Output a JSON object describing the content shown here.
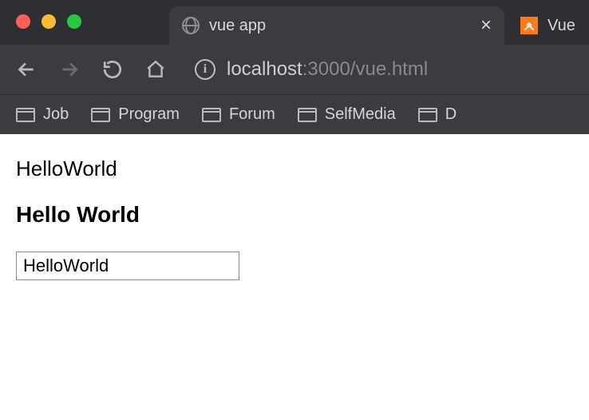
{
  "tabs": {
    "active": {
      "title": "vue app"
    },
    "inactive": {
      "title": "Vue"
    }
  },
  "address": {
    "host": "localhost",
    "port": ":3000",
    "path": "/vue.html"
  },
  "bookmarks": [
    {
      "label": "Job"
    },
    {
      "label": "Program"
    },
    {
      "label": "Forum"
    },
    {
      "label": "SelfMedia"
    },
    {
      "label": "D"
    }
  ],
  "content": {
    "text": "HelloWorld",
    "heading": "Hello World",
    "input_value": "HelloWorld"
  }
}
